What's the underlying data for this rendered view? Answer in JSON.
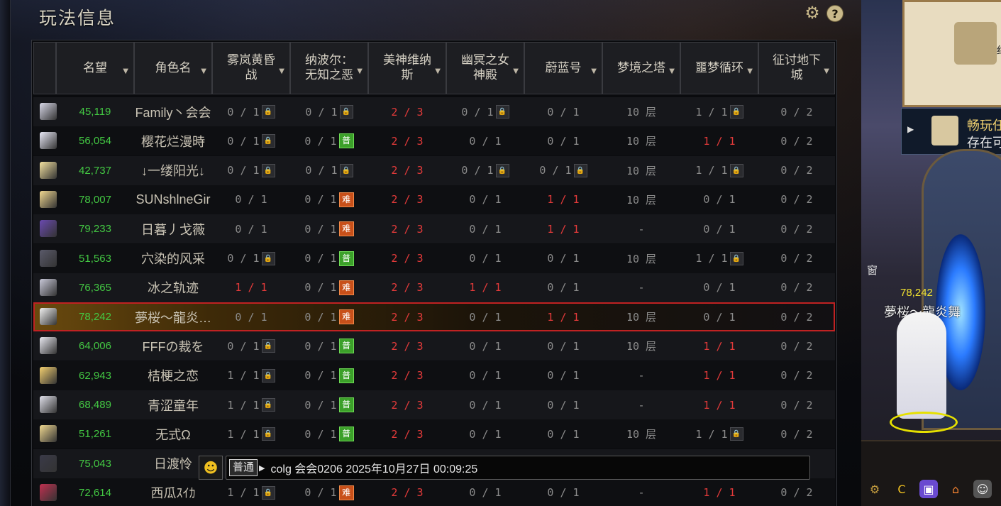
{
  "window": {
    "title": "玩法信息"
  },
  "columns": [
    {
      "label": "",
      "sortable": false
    },
    {
      "label": "名望",
      "sortable": true
    },
    {
      "label": "角色名",
      "sortable": true
    },
    {
      "label": "雾岚黄昏战",
      "sortable": true
    },
    {
      "label": "纳波尔：无知之恶",
      "sortable": true
    },
    {
      "label": "美神维纳斯",
      "sortable": true
    },
    {
      "label": "幽冥之女神殿",
      "sortable": true
    },
    {
      "label": "蔚蓝号",
      "sortable": true
    },
    {
      "label": "梦境之塔",
      "sortable": true
    },
    {
      "label": "噩梦循环",
      "sortable": true
    },
    {
      "label": "征讨地下城",
      "sortable": true
    }
  ],
  "tag_text": {
    "pu": "普",
    "nan": "难"
  },
  "rows": [
    {
      "fame": "45,119",
      "name": "Family丶会会",
      "cells": [
        [
          "0 / 1",
          "lock"
        ],
        [
          "0 / 1",
          "lock"
        ],
        [
          "2 / 3",
          "red"
        ],
        [
          "0 / 1",
          "lock"
        ],
        [
          "0 / 1",
          ""
        ],
        [
          "10 层",
          ""
        ],
        [
          "1 / 1",
          "lock"
        ],
        [
          "0 / 2",
          ""
        ]
      ],
      "color": "#d8d8e8"
    },
    {
      "fame": "56,054",
      "name": "樱花烂漫時",
      "cells": [
        [
          "0 / 1",
          "lock"
        ],
        [
          "0 / 1",
          "pu"
        ],
        [
          "2 / 3",
          "red"
        ],
        [
          "0 / 1",
          ""
        ],
        [
          "0 / 1",
          ""
        ],
        [
          "10 层",
          ""
        ],
        [
          "1 / 1",
          "red"
        ],
        [
          "0 / 2",
          ""
        ]
      ],
      "color": "#eaeaf8"
    },
    {
      "fame": "42,737",
      "name": "↓一缕阳光↓",
      "cells": [
        [
          "0 / 1",
          "lock"
        ],
        [
          "0 / 1",
          "lock"
        ],
        [
          "2 / 3",
          "red"
        ],
        [
          "0 / 1",
          "lock"
        ],
        [
          "0 / 1",
          "lock"
        ],
        [
          "10 层",
          ""
        ],
        [
          "1 / 1",
          "lock"
        ],
        [
          "0 / 2",
          ""
        ]
      ],
      "color": "#f4e2a0"
    },
    {
      "fame": "78,007",
      "name": "SUNshlneGir",
      "cells": [
        [
          "0 / 1",
          ""
        ],
        [
          "0 / 1",
          "nan"
        ],
        [
          "2 / 3",
          "red"
        ],
        [
          "0 / 1",
          ""
        ],
        [
          "1 / 1",
          "red"
        ],
        [
          "10 层",
          ""
        ],
        [
          "0 / 1",
          ""
        ],
        [
          "0 / 2",
          ""
        ]
      ],
      "color": "#f2d890"
    },
    {
      "fame": "79,233",
      "name": "日暮丿戈薇",
      "cells": [
        [
          "0 / 1",
          ""
        ],
        [
          "0 / 1",
          "nan"
        ],
        [
          "2 / 3",
          "red"
        ],
        [
          "0 / 1",
          ""
        ],
        [
          "1 / 1",
          "red"
        ],
        [
          "-",
          ""
        ],
        [
          "0 / 1",
          ""
        ],
        [
          "0 / 2",
          ""
        ]
      ],
      "color": "#6a4ab0"
    },
    {
      "fame": "51,563",
      "name": "穴染的风采",
      "cells": [
        [
          "0 / 1",
          "lock"
        ],
        [
          "0 / 1",
          "pu"
        ],
        [
          "2 / 3",
          "red"
        ],
        [
          "0 / 1",
          ""
        ],
        [
          "0 / 1",
          ""
        ],
        [
          "10 层",
          ""
        ],
        [
          "1 / 1",
          "lock"
        ],
        [
          "0 / 2",
          ""
        ]
      ],
      "color": "#5a5a6a"
    },
    {
      "fame": "76,365",
      "name": "冰之轨迹",
      "cells": [
        [
          "1 / 1",
          "red"
        ],
        [
          "0 / 1",
          "nan"
        ],
        [
          "2 / 3",
          "red"
        ],
        [
          "1 / 1",
          "red"
        ],
        [
          "0 / 1",
          ""
        ],
        [
          "-",
          ""
        ],
        [
          "0 / 1",
          ""
        ],
        [
          "0 / 2",
          ""
        ]
      ],
      "color": "#c8c8d8"
    },
    {
      "fame": "78,242",
      "name": "夢桜～龍炎…",
      "cells": [
        [
          "0 / 1",
          ""
        ],
        [
          "0 / 1",
          "nan"
        ],
        [
          "2 / 3",
          "red"
        ],
        [
          "0 / 1",
          ""
        ],
        [
          "1 / 1",
          "red"
        ],
        [
          "10 层",
          ""
        ],
        [
          "0 / 1",
          ""
        ],
        [
          "0 / 2",
          ""
        ]
      ],
      "color": "#f0f0f0",
      "selected": true
    },
    {
      "fame": "64,006",
      "name": "FFFの裁を",
      "cells": [
        [
          "0 / 1",
          "lock"
        ],
        [
          "0 / 1",
          "pu"
        ],
        [
          "2 / 3",
          "red"
        ],
        [
          "0 / 1",
          ""
        ],
        [
          "0 / 1",
          ""
        ],
        [
          "10 层",
          ""
        ],
        [
          "1 / 1",
          "red"
        ],
        [
          "0 / 2",
          ""
        ]
      ],
      "color": "#e8e8f0"
    },
    {
      "fame": "62,943",
      "name": "桔梗之恋",
      "cells": [
        [
          "1 / 1",
          "lock"
        ],
        [
          "0 / 1",
          "pu"
        ],
        [
          "2 / 3",
          "red"
        ],
        [
          "0 / 1",
          ""
        ],
        [
          "0 / 1",
          ""
        ],
        [
          "-",
          ""
        ],
        [
          "1 / 1",
          "red"
        ],
        [
          "0 / 2",
          ""
        ]
      ],
      "color": "#f4d070"
    },
    {
      "fame": "68,489",
      "name": "青涩童年",
      "cells": [
        [
          "1 / 1",
          "lock"
        ],
        [
          "0 / 1",
          "pu"
        ],
        [
          "2 / 3",
          "red"
        ],
        [
          "0 / 1",
          ""
        ],
        [
          "0 / 1",
          ""
        ],
        [
          "-",
          ""
        ],
        [
          "1 / 1",
          "red"
        ],
        [
          "0 / 2",
          ""
        ]
      ],
      "color": "#e0e0ea"
    },
    {
      "fame": "51,261",
      "name": "无式Ω",
      "cells": [
        [
          "1 / 1",
          "lock"
        ],
        [
          "0 / 1",
          "pu"
        ],
        [
          "2 / 3",
          "red"
        ],
        [
          "0 / 1",
          ""
        ],
        [
          "0 / 1",
          ""
        ],
        [
          "10 层",
          ""
        ],
        [
          "1 / 1",
          "lock"
        ],
        [
          "0 / 2",
          ""
        ]
      ],
      "color": "#f0d890"
    },
    {
      "fame": "75,043",
      "name": "日渡怜",
      "cells": [
        [
          "",
          ""
        ],
        [
          "",
          ""
        ],
        [
          "",
          ""
        ],
        [
          "",
          ""
        ],
        [
          "",
          ""
        ],
        [
          "",
          ""
        ],
        [
          "",
          ""
        ],
        [
          "",
          ""
        ]
      ],
      "color": "#3a3a48"
    },
    {
      "fame": "72,614",
      "name": "西瓜ｽｲｶ",
      "cells": [
        [
          "1 / 1",
          "lock"
        ],
        [
          "0 / 1",
          "nan"
        ],
        [
          "2 / 3",
          "red"
        ],
        [
          "0 / 1",
          ""
        ],
        [
          "0 / 1",
          ""
        ],
        [
          "-",
          ""
        ],
        [
          "1 / 1",
          "red"
        ],
        [
          "0 / 2",
          ""
        ]
      ],
      "color": "#c03050"
    }
  ],
  "chat": {
    "channel": "普通",
    "message": "colg 会会0206 2025年10月27日 00:09:25"
  },
  "scene": {
    "quest_line1": "畅玩任",
    "quest_line2": "存在可",
    "map_label": "红",
    "player_fame": "78,242",
    "player_name": "夢桜～龍炎舞",
    "side_char": "窗"
  },
  "icons": {
    "settings": "gear-icon",
    "help": "help-icon"
  }
}
